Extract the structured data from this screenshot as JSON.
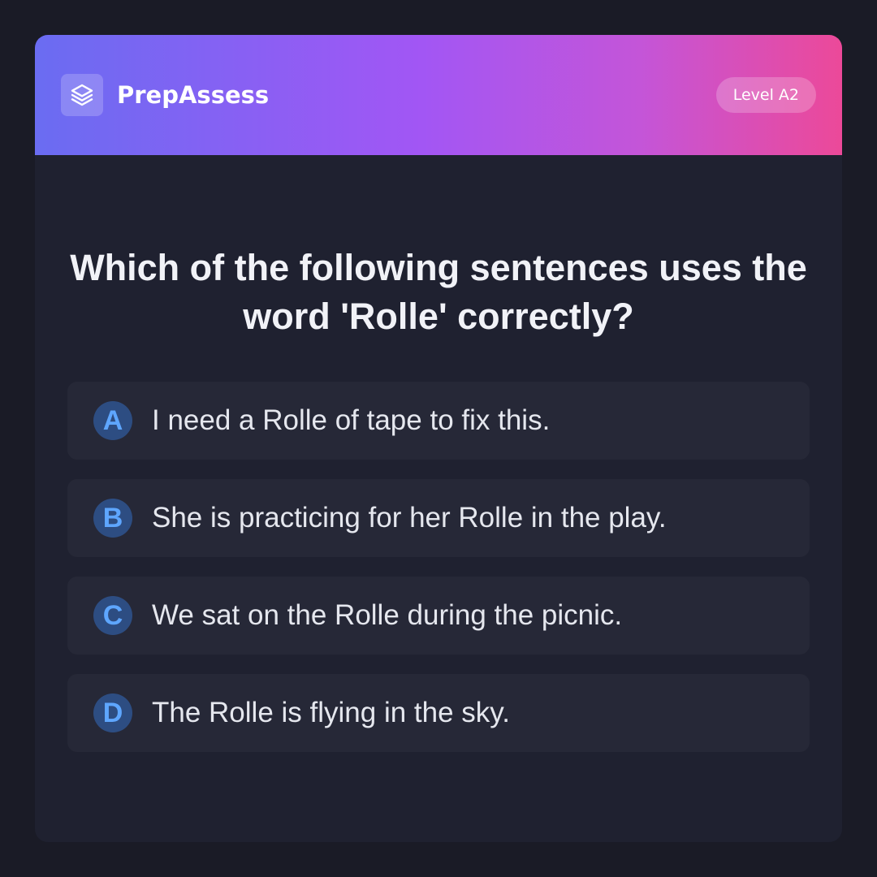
{
  "header": {
    "brand_name": "PrepAssess",
    "logo_icon": "layers-icon",
    "level_badge": "Level A2"
  },
  "colors": {
    "page_background": "#1a1b26",
    "card_background": "#1f2130",
    "header_gradient": [
      "#6a6cf2",
      "#a256f4",
      "#ec4999"
    ],
    "option_background": "#262837",
    "option_letter_background": "#2d4d82",
    "option_letter_color": "#5ea6ff"
  },
  "question": {
    "text": "Which of the following sentences uses the word 'Rolle' correctly?"
  },
  "options": [
    {
      "letter": "A",
      "text": "I need a Rolle of tape to fix this."
    },
    {
      "letter": "B",
      "text": "She is practicing for her Rolle in the play."
    },
    {
      "letter": "C",
      "text": "We sat on the Rolle during the picnic."
    },
    {
      "letter": "D",
      "text": "The Rolle is flying in the sky."
    }
  ]
}
